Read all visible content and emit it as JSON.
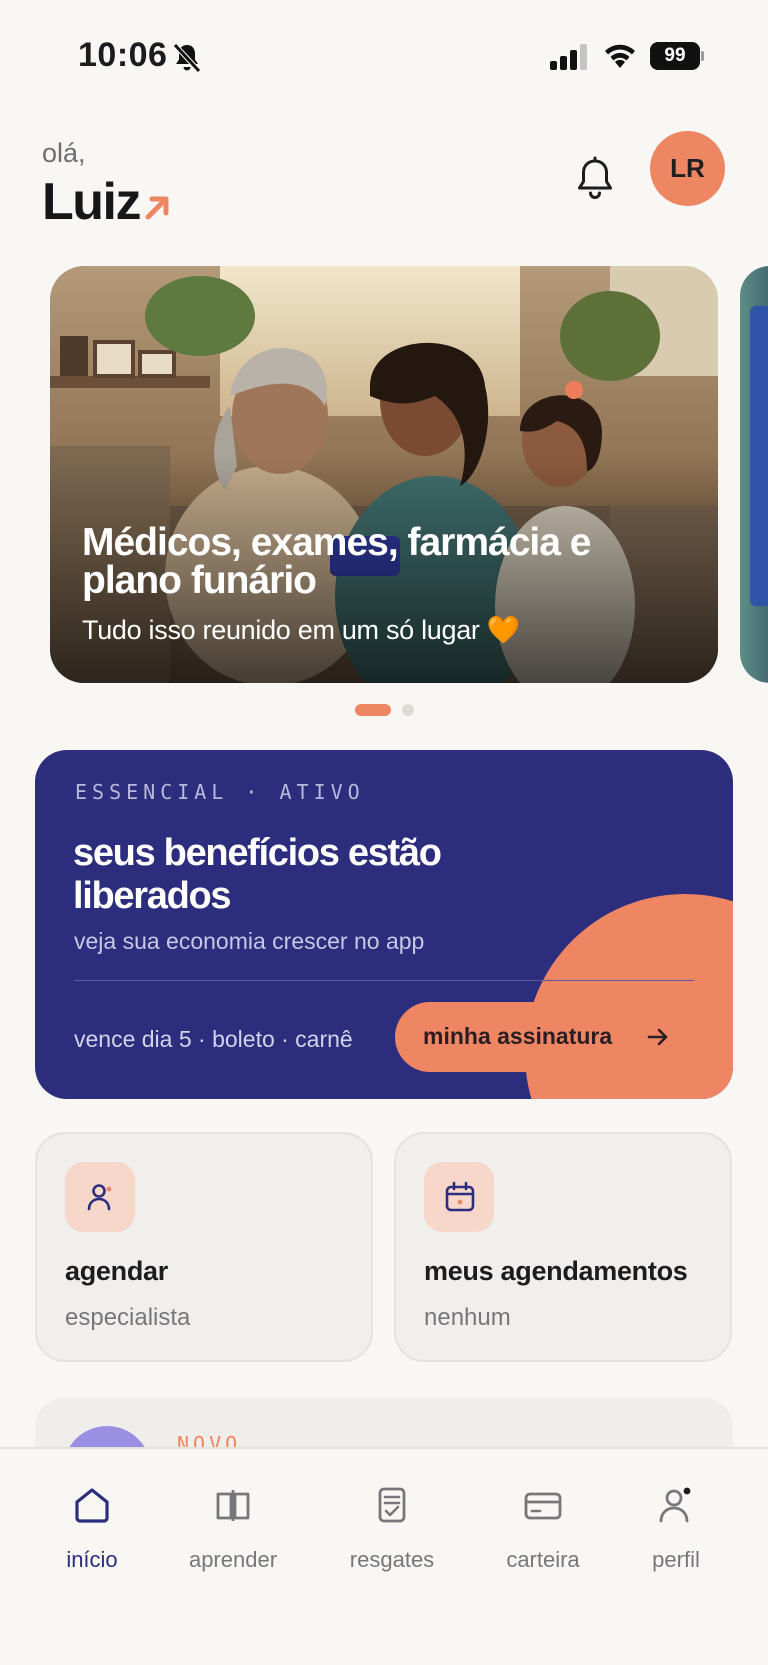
{
  "status_bar": {
    "time": "10:06",
    "battery": "99"
  },
  "header": {
    "greeting": "olá,",
    "name": "Luiz",
    "avatar_initials": "LR"
  },
  "hero": {
    "title": "Médicos, exames, farmácia e plano funário",
    "subtitle": "Tudo isso reunido em um só lugar 🧡",
    "page_count": 2,
    "active_page": 1
  },
  "plan": {
    "eyebrow": "ESSENCIAL · ATIVO",
    "title": "seus benefícios estão liberados",
    "subtitle": "veja sua economia crescer no app",
    "due": "vence dia 5 · boleto · carnê",
    "button_label": "minha assinatura"
  },
  "tiles": [
    {
      "title": "agendar",
      "subtitle": "especialista",
      "icon": "person-icon"
    },
    {
      "title": "meus agendamentos",
      "subtitle": "nenhum",
      "icon": "calendar-icon"
    }
  ],
  "peek_card": {
    "eyebrow": "NOVO"
  },
  "nav": {
    "items": [
      {
        "label": "início",
        "icon": "home-icon",
        "active": true
      },
      {
        "label": "aprender",
        "icon": "book-icon",
        "active": false
      },
      {
        "label": "resgates",
        "icon": "receipt-icon",
        "active": false
      },
      {
        "label": "carteira",
        "icon": "card-icon",
        "active": false
      },
      {
        "label": "perfil",
        "icon": "profile-icon",
        "active": false
      }
    ]
  },
  "colors": {
    "background": "#f8f7f3",
    "brand_navy": "#2d2d7e",
    "accent_coral": "#ee8663",
    "tile_bg": "#f1efeb"
  }
}
